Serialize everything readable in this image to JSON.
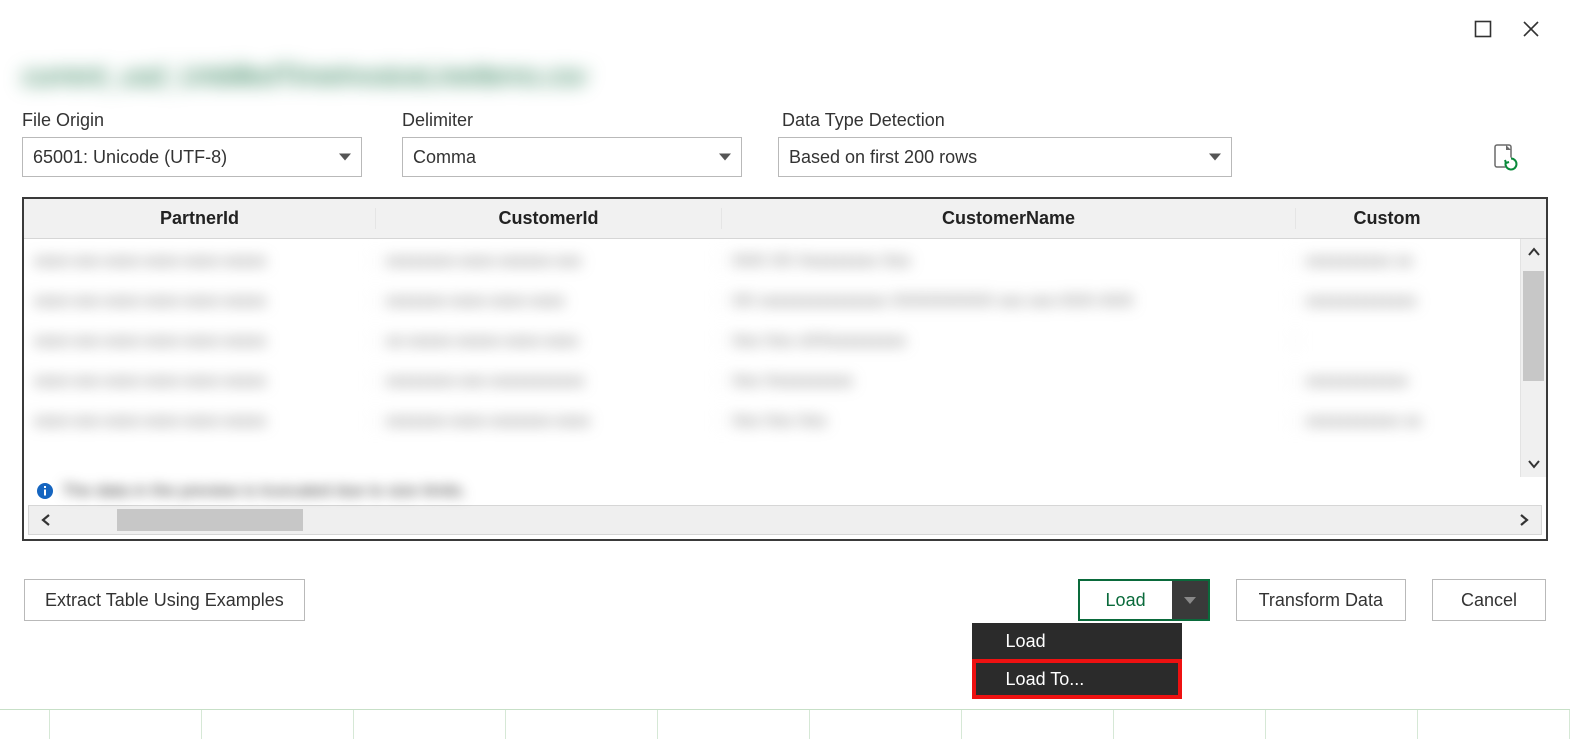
{
  "dialog": {
    "title_blurred": "current_usd_UnbilledTimeInvoiceLineItems.csv",
    "file_origin_label": "File Origin",
    "delimiter_label": "Delimiter",
    "data_type_label": "Data Type Detection",
    "file_origin_value": "65001: Unicode (UTF-8)",
    "delimiter_value": "Comma",
    "data_type_value": "Based on first 200 rows"
  },
  "table": {
    "headers": [
      "PartnerId",
      "CustomerId",
      "CustomerName",
      "Custom"
    ],
    "info_blurred": "The data in the preview is truncated due to size limits."
  },
  "buttons": {
    "extract": "Extract Table Using Examples",
    "load": "Load",
    "transform": "Transform Data",
    "cancel": "Cancel"
  },
  "menu": {
    "load": "Load",
    "load_to": "Load To..."
  }
}
